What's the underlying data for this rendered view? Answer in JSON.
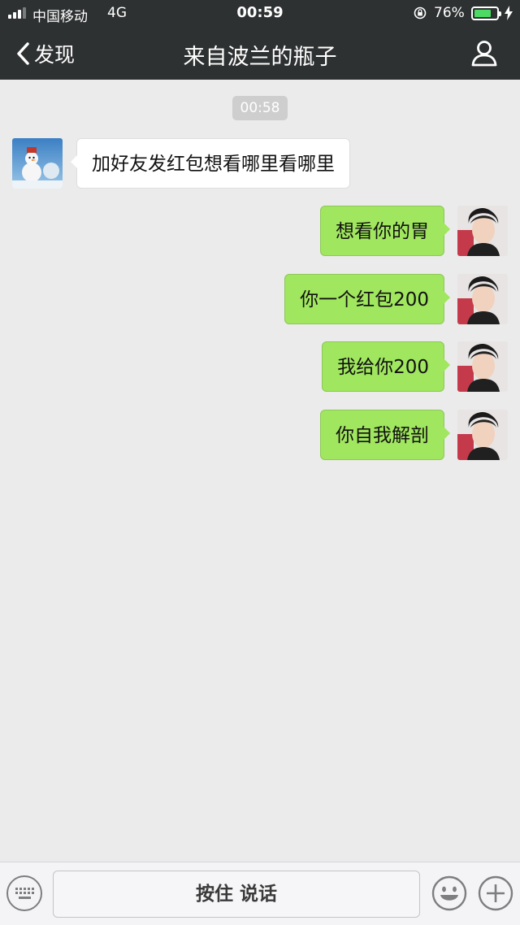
{
  "status_bar": {
    "carrier": "中国移动",
    "network": "4G",
    "time": "00:59",
    "battery_percent": "76%",
    "battery_level": 0.76,
    "battery_color": "#4cd964"
  },
  "nav": {
    "back_label": "发现",
    "title": "来自波兰的瓶子",
    "profile_icon": "person-icon"
  },
  "chat": {
    "timestamp": "00:58",
    "messages": [
      {
        "side": "left",
        "text": "加好友发红包想看哪里看哪里"
      },
      {
        "side": "right",
        "text": "想看你的胃"
      },
      {
        "side": "right",
        "text": "你一个红包200"
      },
      {
        "side": "right",
        "text": "我给你200"
      },
      {
        "side": "right",
        "text": "你自我解剖"
      }
    ],
    "bubble_colors": {
      "left": "#ffffff",
      "right": "#a0e65e"
    }
  },
  "input_bar": {
    "hold_to_talk": "按住 说话",
    "left_icon": "keyboard-icon",
    "emoji_icon": "emoji-icon",
    "plus_icon": "plus-icon"
  }
}
